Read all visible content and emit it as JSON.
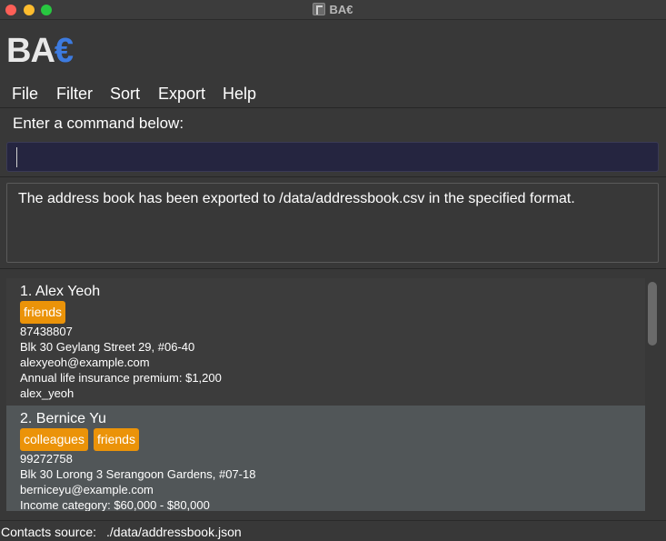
{
  "window": {
    "title": "BA€"
  },
  "logo": {
    "main": "BA",
    "accent": "€"
  },
  "menu": {
    "items": [
      "File",
      "Filter",
      "Sort",
      "Export",
      "Help"
    ]
  },
  "command": {
    "label": "Enter a command below:",
    "value": ""
  },
  "result": {
    "message": "The address book has been exported to /data/addressbook.csv in the specified format."
  },
  "contacts": [
    {
      "name": "1. Alex Yeoh",
      "tags": [
        "friends"
      ],
      "phone": "87438807",
      "address": "Blk 30 Geylang Street 29, #06-40",
      "email": "alexyeoh@example.com",
      "extra": "Annual life insurance premium: $1,200",
      "handle": "alex_yeoh"
    },
    {
      "name": "2. Bernice Yu",
      "tags": [
        "colleagues",
        "friends"
      ],
      "phone": "99272758",
      "address": "Blk 30 Lorong 3 Serangoon Gardens, #07-18",
      "email": "berniceyu@example.com",
      "extra": "Income category: $60,000 - $80,000"
    }
  ],
  "status": {
    "label": "Contacts source:",
    "value": "./data/addressbook.json"
  },
  "colors": {
    "background": "#383838",
    "tag": "#eb9309",
    "logo_accent": "#3d7be0",
    "command_box": "#252540"
  }
}
